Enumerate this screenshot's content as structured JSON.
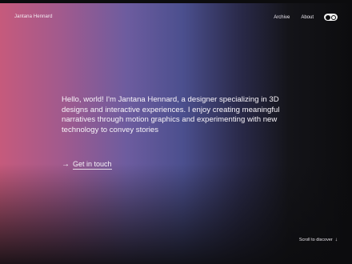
{
  "header": {
    "brand": "Jantana Hennard",
    "nav": [
      {
        "label": "Archive"
      },
      {
        "label": "About"
      }
    ],
    "theme_toggle": {
      "icon": "theme-toggle-icon"
    }
  },
  "hero": {
    "intro": "Hello, world! I'm Jantana Hennard, a designer specializing in 3D designs and interactive experiences. I enjoy creating meaningful narratives through motion graphics and experimenting with new technology to convey stories",
    "cta": {
      "icon": "arrow-right-icon",
      "label": "Get in touch"
    }
  },
  "footer": {
    "scroll_label": "Scroll to discover",
    "scroll_icon": "arrow-down-icon"
  },
  "colors": {
    "gradient_pink": "#c65a7c",
    "gradient_violet": "#6d5c9f",
    "background_dark": "#0c0c0e",
    "text": "#f7f3f8"
  }
}
